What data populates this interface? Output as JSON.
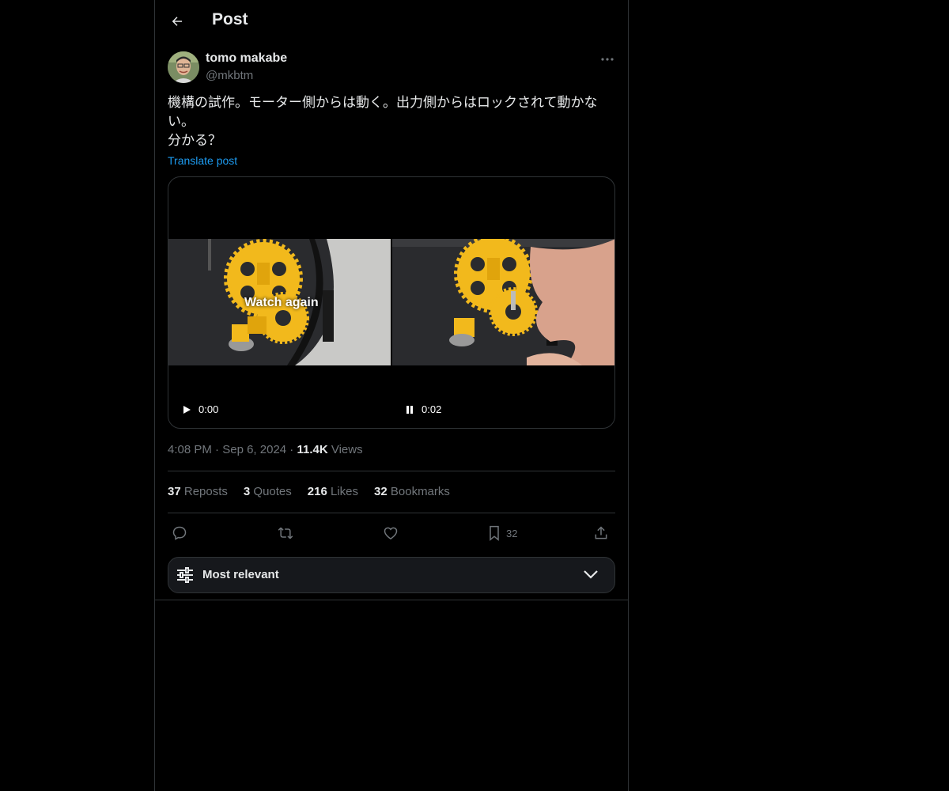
{
  "header": {
    "title": "Post",
    "back_icon": "arrow-left-icon"
  },
  "author": {
    "display_name": "tomo makabe",
    "handle": "@mkbtm"
  },
  "post": {
    "text_lines": [
      "機構の試作。モーター側からは動く。出力側からはロックされて動かな",
      "い。",
      "分かる？"
    ],
    "translate_label": "Translate post"
  },
  "media": {
    "overlay_label": "Watch again",
    "left_video": {
      "time": "0:00",
      "state": "play-icon"
    },
    "right_video": {
      "time": "0:02",
      "state": "pause-icon"
    }
  },
  "meta": {
    "time": "4:08 PM",
    "date": "Sep 6, 2024",
    "views_count": "11.4K",
    "views_label": "Views",
    "separator": "·"
  },
  "stats": [
    {
      "count": "37",
      "label": "Reposts"
    },
    {
      "count": "3",
      "label": "Quotes"
    },
    {
      "count": "216",
      "label": "Likes"
    },
    {
      "count": "32",
      "label": "Bookmarks"
    }
  ],
  "actions": {
    "bookmark_count": "32"
  },
  "sort": {
    "label": "Most relevant"
  },
  "colors": {
    "background": "#000000",
    "accent": "#1d9bf0",
    "muted": "#71767b",
    "gear": "#f2b91c"
  }
}
